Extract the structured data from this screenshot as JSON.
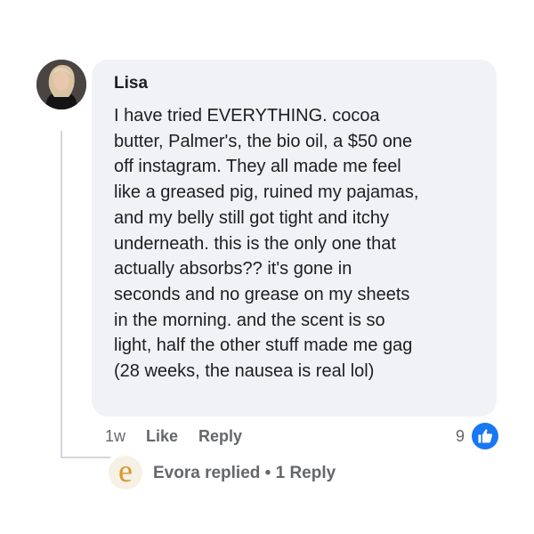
{
  "comment": {
    "author": "Lisa",
    "text": "I have tried EVERYTHING. cocoa\nbutter, Palmer's, the bio oil, a $50 one\noff instagram. They all made me feel\nlike a greased pig, ruined my pajamas,\nand my belly still got tight and itchy\nunderneath. this is the only one that\nactually absorbs?? it's gone in\nseconds and no grease on my sheets\nin the morning. and the scent is so\nlight, half the other stuff made me gag\n(28 weeks, the nausea is real lol)",
    "timestamp": "1w",
    "like_label": "Like",
    "reply_label": "Reply",
    "like_count": "9"
  },
  "reply_preview": {
    "avatar_letter": "e",
    "text": "Evora replied • 1 Reply"
  },
  "icons": {
    "like_badge": "thumbs-up-icon"
  },
  "colors": {
    "bubble_bg": "#f0f2f5",
    "like_blue": "#1877f2",
    "muted_text": "#65676b",
    "brand_gold": "#d79b2d"
  }
}
